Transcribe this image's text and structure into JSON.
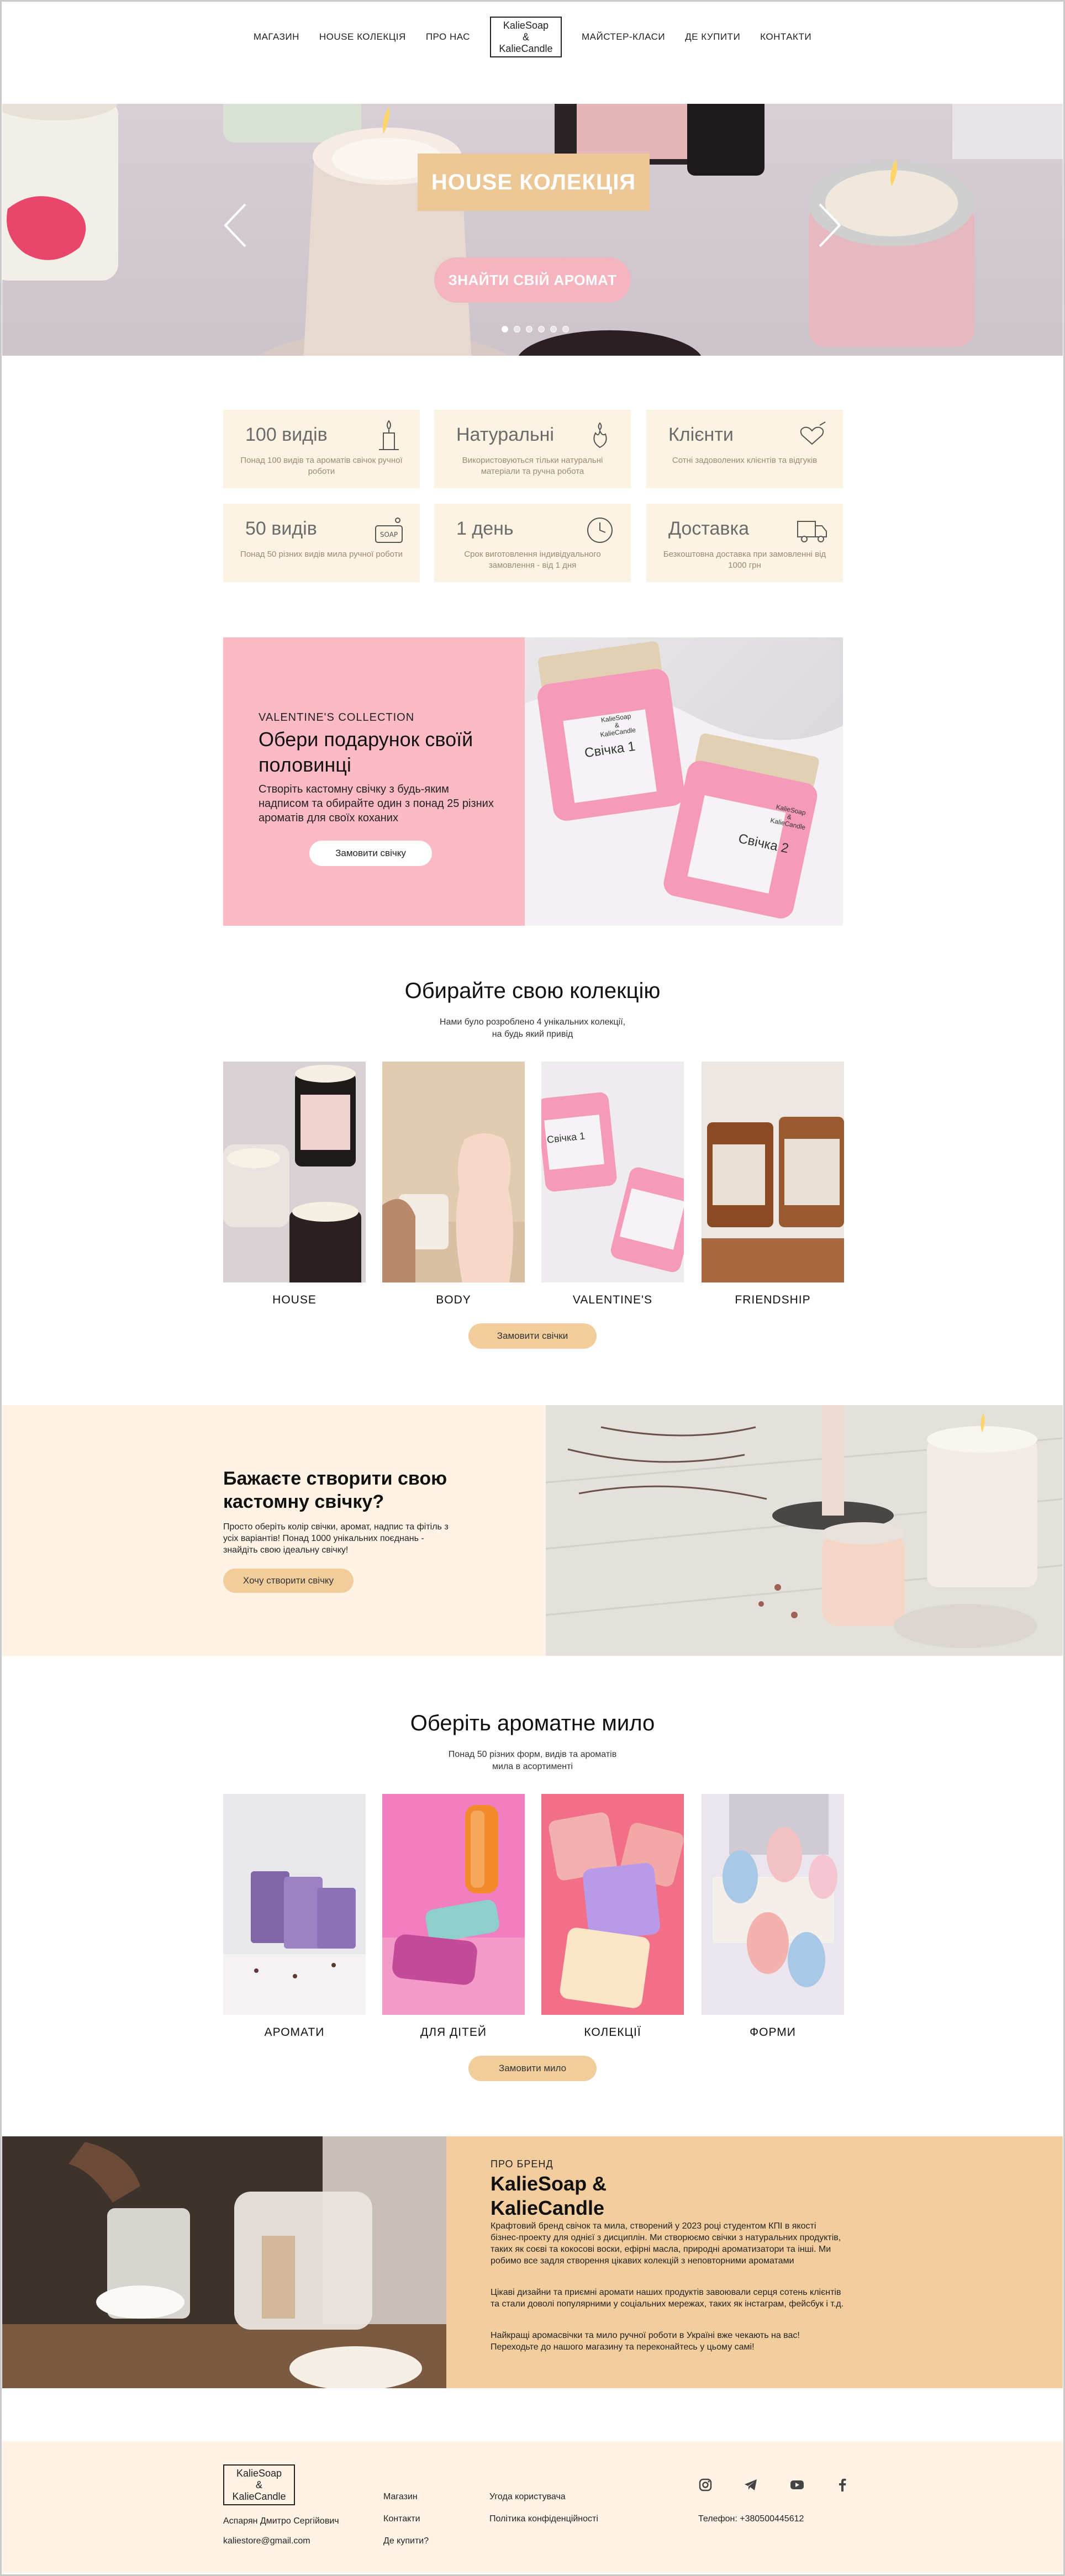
{
  "nav": {
    "left": [
      "МАГАЗИН",
      "HOUSE КОЛЕКЦІЯ",
      "ПРО НАС"
    ],
    "logo": [
      "KalieSoap",
      "&",
      "KalieCandle"
    ],
    "right": [
      "МАЙСТЕР-КЛАСИ",
      "ДЕ КУПИТИ",
      "КОНТАКТИ"
    ]
  },
  "hero": {
    "title": "HOUSE КОЛЕКЦІЯ",
    "button": "ЗНАЙТИ СВІЙ АРОМАТ",
    "slides": 6,
    "active_slide": 1
  },
  "features": [
    {
      "title": "100 видів",
      "desc": "Понад 100 видів та ароматів свічок ручної роботи",
      "icon": "candle-icon"
    },
    {
      "title": "Натуральні",
      "desc": "Використовуються тільки натуральні матеріали та ручна робота",
      "icon": "leaf-flame-icon"
    },
    {
      "title": "Клієнти",
      "desc": "Сотні задоволених клієнтів та відгуків",
      "icon": "heart-hand-icon"
    },
    {
      "title": "50 видів",
      "desc": "Понад 50 різних видів мила ручної роботи",
      "icon": "soap-icon"
    },
    {
      "title": "1 день",
      "desc": "Срок виготовлення індивідуального замовлення - від 1 дня",
      "icon": "clock-icon"
    },
    {
      "title": "Доставка",
      "desc": "Безкоштовна доставка при замовленні від 1000 грн",
      "icon": "truck-icon"
    }
  ],
  "valentine": {
    "kicker": "VALENTINE'S COLLECTION",
    "title": "Обери подарунок своїй половинці",
    "desc": "Створіть кастомну свічку з будь-яким надписом та обирайте один з понад 25 різних ароматів для своїх коханих",
    "button": "Замовити свічку",
    "jar1": "Свічка 1",
    "jar2": "Свічка 2",
    "jar_brand": [
      "KalieSoap",
      "&",
      "KalieCandle"
    ]
  },
  "collections": {
    "title": "Обирайте свою колекцію",
    "subtitle": "Нами було розроблено 4 унікальних колекції, на будь який привід",
    "items": [
      "HOUSE",
      "BODY",
      "VALENTINE'S",
      "FRIENDSHIP"
    ],
    "button": "Замовити свічки"
  },
  "custom": {
    "title": "Бажаєте створити свою кастомну свічку?",
    "desc": "Просто оберіть колір свічки, аромат, надпис та фітіль з усіх варіантів! Понад 1000 унікальних поєднань - знайдіть свою ідеальну свічку!",
    "button": "Хочу створити свічку"
  },
  "soap": {
    "title": "Оберіть ароматне мило",
    "subtitle": "Понад 50 різних форм, видів та ароматів мила в асортименті",
    "items": [
      "АРОМАТИ",
      "ДЛЯ ДІТЕЙ",
      "КОЛЕКЦІЇ",
      "ФОРМИ"
    ],
    "button": "Замовити мило"
  },
  "brand": {
    "kicker": "ПРО БРЕНД",
    "title": "KalieSoap & KalieCandle",
    "p1": "Крафтовий бренд свічок та мила, створений у 2023 році студентом КПІ в якості бізнес-проекту для однієї з дисциплін. Ми створюємо свічки з натуральних продуктів, таких як соєві та кокосові воски, ефірні масла, природні ароматизатори та інші. Ми робимо все задля створення цікавих колекцій з неповторними ароматами",
    "p2": "Цікаві дизайни та приємні аромати наших продуктів завоювали серця сотень клієнтів та стали доволі популярними у соціальних мережах, таких як інстаграм, фейсбук і т.д.",
    "p3": "Найкращі аромасвічки та мило ручної роботи в Україні вже чекають на вас! Переходьте до нашого магазину та переконайтесь у цьому самі!"
  },
  "footer": {
    "logo": [
      "KalieSoap",
      "&",
      "KalieCandle"
    ],
    "owner": "Аспарян Дмитро Сергійович",
    "email": "kaliestore@gmail.com",
    "links1": [
      "Магазин",
      "Контакти",
      "Де купити?"
    ],
    "links2": [
      "Угода користувача",
      "Політика конфіденційності"
    ],
    "phone": "Телефон: +380500445612",
    "social": [
      "instagram-icon",
      "telegram-icon",
      "youtube-icon",
      "facebook-icon"
    ]
  },
  "colors": {
    "peach": "#f2cd9c",
    "pink": "#fbbac4",
    "cream": "#fef3e5",
    "hero_badge": "#ecc896",
    "hero_button": "#f4b5c1"
  }
}
